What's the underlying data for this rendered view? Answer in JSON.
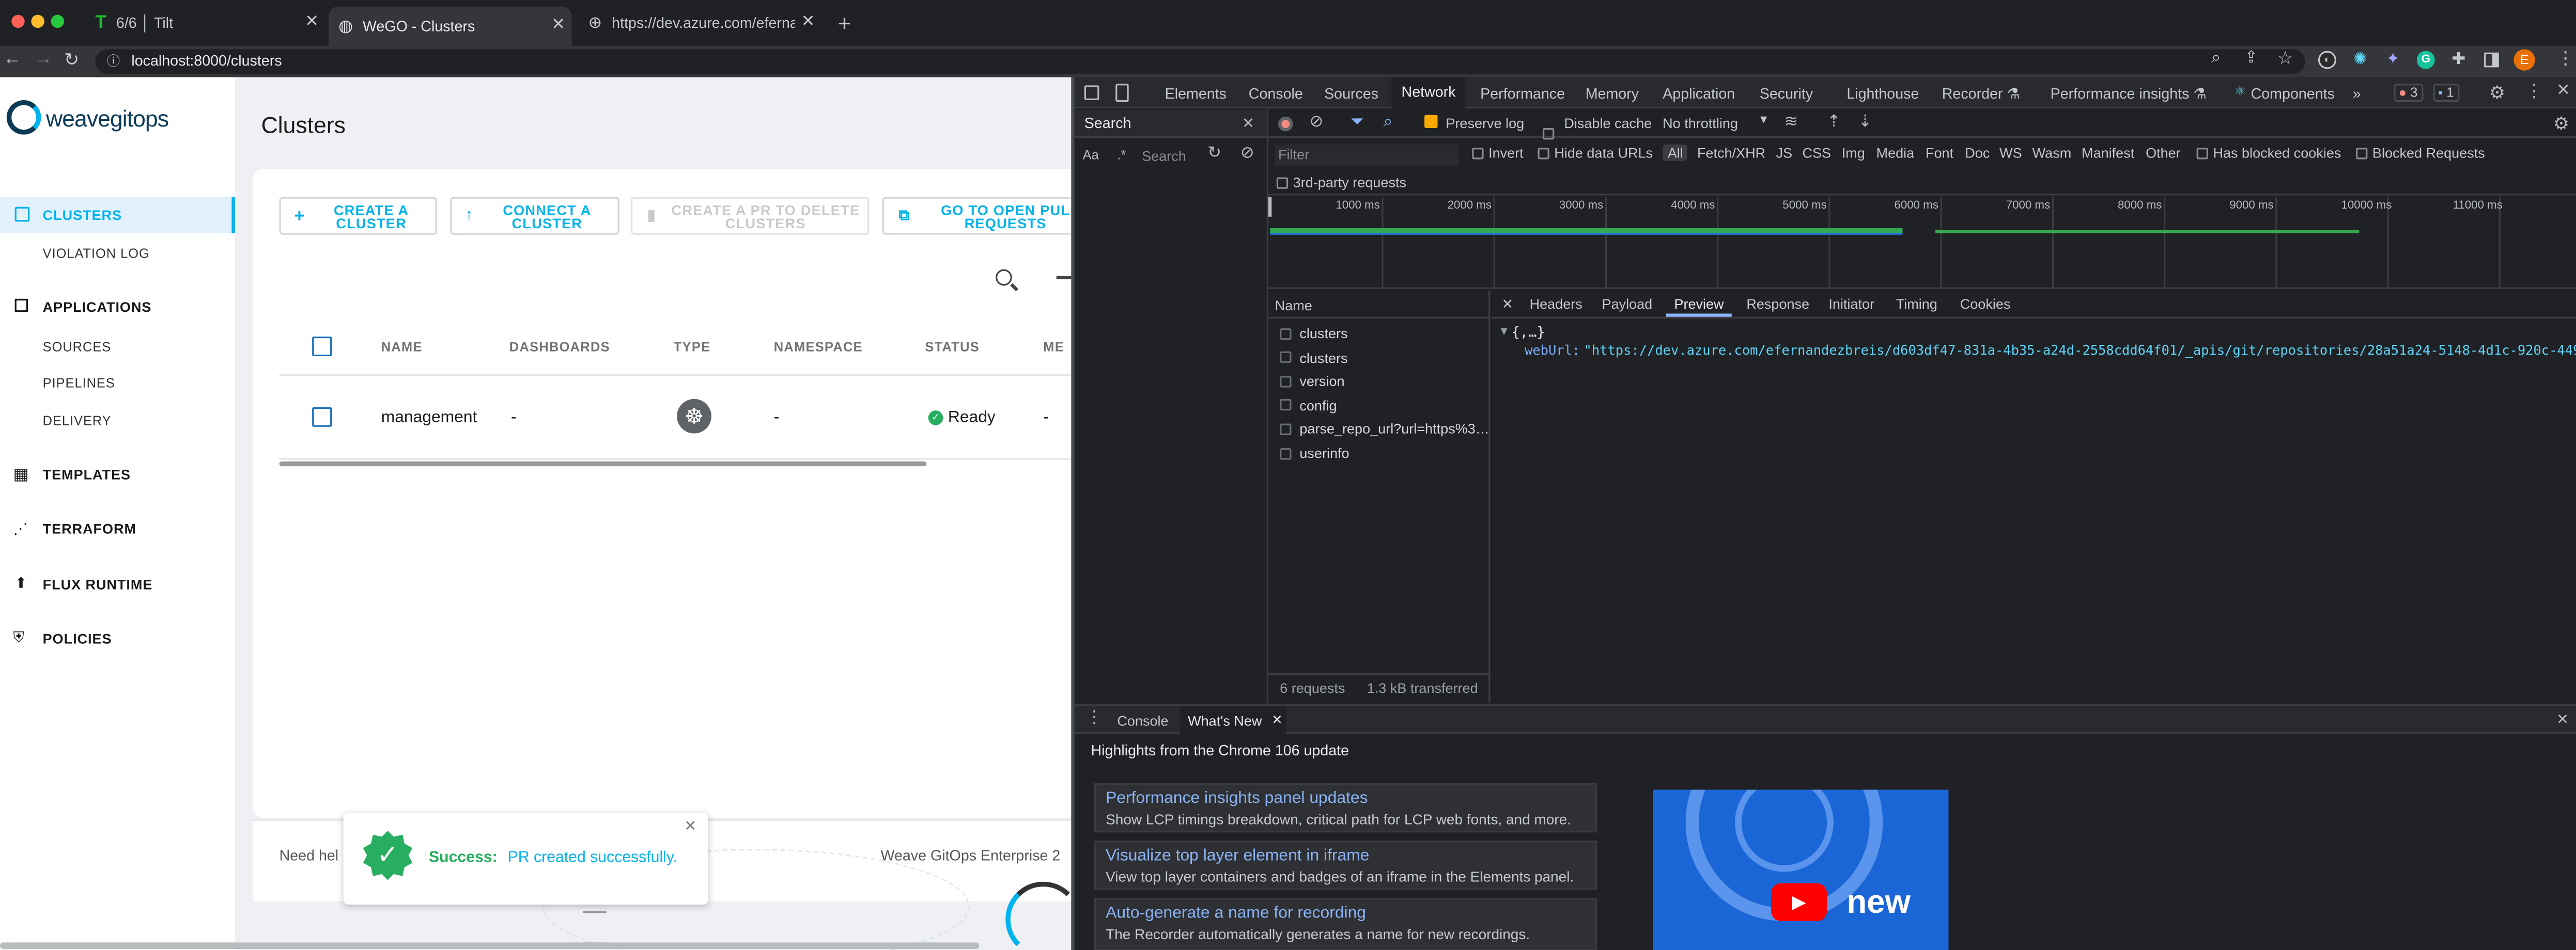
{
  "browser": {
    "tabs": [
      {
        "title": "6/6 │ Tilt",
        "active": false
      },
      {
        "title": "WeGO - Clusters",
        "active": true
      },
      {
        "title": "https://dev.azure.com/efernan…",
        "active": false
      }
    ],
    "url": "localhost:8000/clusters",
    "profile_initial": "E"
  },
  "app": {
    "logo_text": "weavegitops",
    "page_title": "Clusters",
    "sidebar": {
      "clusters": "CLUSTERS",
      "violation_log": "VIOLATION LOG",
      "applications": "APPLICATIONS",
      "sources": "SOURCES",
      "pipelines": "PIPELINES",
      "delivery": "DELIVERY",
      "templates": "TEMPLATES",
      "terraform": "TERRAFORM",
      "flux_runtime": "FLUX RUNTIME",
      "policies": "POLICIES"
    },
    "actions": {
      "create_1": "CREATE A",
      "create_2": "CLUSTER",
      "connect_1": "CONNECT A",
      "connect_2": "CLUSTER",
      "delete_1": "CREATE A PR TO DELETE",
      "delete_2": "CLUSTERS",
      "open_1": "GO TO OPEN PUL",
      "open_2": "REQUESTS"
    },
    "table": {
      "headers": {
        "name": "NAME",
        "dashboards": "DASHBOARDS",
        "type": "TYPE",
        "namespace": "NAMESPACE",
        "status": "STATUS",
        "more": "ME"
      },
      "row": {
        "name": "management",
        "dashboards": "-",
        "namespace": "-",
        "status": "Ready",
        "more": "-"
      }
    },
    "footer": {
      "help": "Need hel",
      "brand": "Weave GitOps Enterprise 2"
    },
    "toast": {
      "label": "Success:",
      "message": "PR created successfully."
    },
    "colors": {
      "accent": "#00b3ec",
      "success": "#27ae60",
      "sidebar_active_bg": "#e3f1fc"
    }
  },
  "devtools": {
    "tabs": {
      "elements": "Elements",
      "console": "Console",
      "sources": "Sources",
      "network": "Network",
      "performance": "Performance",
      "memory": "Memory",
      "application": "Application",
      "security": "Security",
      "lighthouse": "Lighthouse",
      "recorder": "Recorder ⚗",
      "perf_insights": "Performance insights ⚗",
      "components": "Components"
    },
    "errors": "3",
    "messages": "1",
    "search_panel": {
      "title": "Search",
      "aa": "Aa",
      "regex": ".*",
      "placeholder": "Search"
    },
    "toolbar": {
      "preserve_log": "Preserve log",
      "disable_cache": "Disable cache",
      "throttling": "No throttling"
    },
    "filter": {
      "placeholder": "Filter",
      "invert": "Invert",
      "hide_data_urls": "Hide data URLs",
      "types": [
        "All",
        "Fetch/XHR",
        "JS",
        "CSS",
        "Img",
        "Media",
        "Font",
        "Doc",
        "WS",
        "Wasm",
        "Manifest",
        "Other"
      ],
      "blocked_cookies": "Has blocked cookies",
      "blocked_requests": "Blocked Requests",
      "third_party": "3rd-party requests"
    },
    "timeline_ticks": [
      "1000 ms",
      "2000 ms",
      "3000 ms",
      "4000 ms",
      "5000 ms",
      "6000 ms",
      "7000 ms",
      "8000 ms",
      "9000 ms",
      "10000 ms",
      "11000 ms",
      "120"
    ],
    "name_header": "Name",
    "requests": [
      "clusters",
      "clusters",
      "version",
      "config",
      "parse_repo_url?url=https%3…",
      "userinfo"
    ],
    "summary": {
      "requests": "6 requests",
      "transferred": "1.3 kB transferred"
    },
    "detail_tabs": {
      "headers": "Headers",
      "payload": "Payload",
      "preview": "Preview",
      "response": "Response",
      "initiator": "Initiator",
      "timing": "Timing",
      "cookies": "Cookies"
    },
    "preview": {
      "root": "{,…}",
      "key": "webUrl:",
      "value": "\"https://dev.azure.com/efernandezbreis/d603df47-831a-4b35-a24d-2558cdd64f01/_apis/git/repositories/28a51a24-5148-4d1c-920c-4493be96a"
    },
    "drawer": {
      "console": "Console",
      "whats_new": "What's New",
      "highlights": "Highlights from the Chrome 106 update",
      "cards": [
        {
          "title": "Performance insights panel updates",
          "desc": "Show LCP timings breakdown, critical path for LCP web fonts, and more."
        },
        {
          "title": "Visualize top layer element in iframe",
          "desc": "View top layer containers and badges of an iframe in the Elements panel."
        },
        {
          "title": "Auto-generate a name for recording",
          "desc": "The Recorder automatically generates a name for new recordings."
        }
      ],
      "video_text": "new"
    }
  }
}
